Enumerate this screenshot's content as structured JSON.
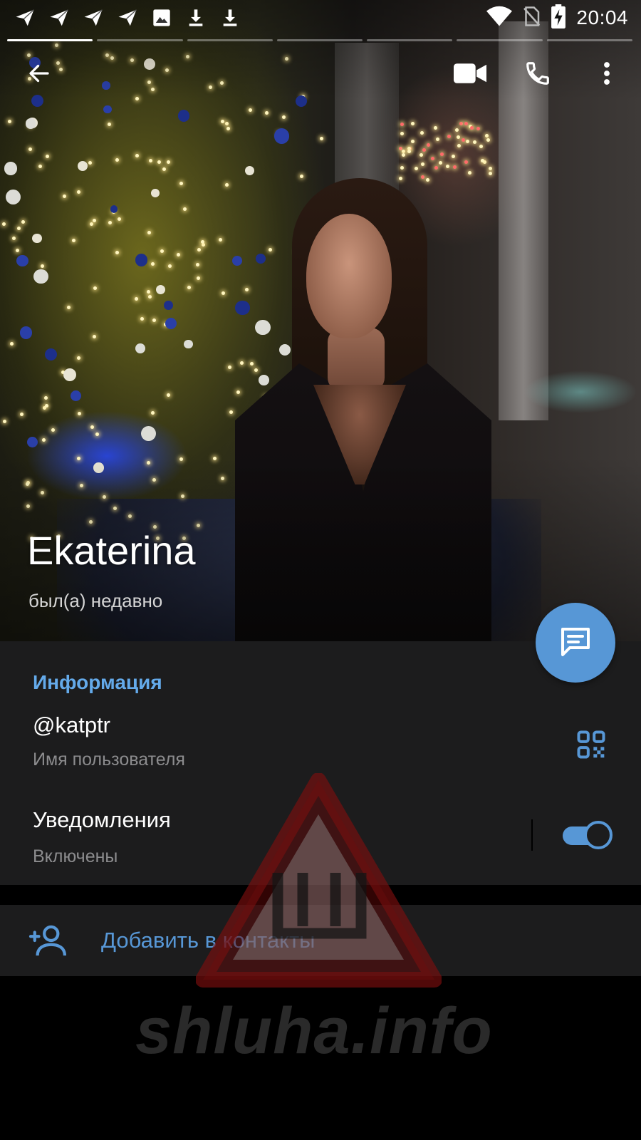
{
  "status_bar": {
    "time": "20:04",
    "left_icons": [
      "telegram-icon",
      "telegram-icon",
      "telegram-icon",
      "telegram-icon",
      "image-icon",
      "download-icon",
      "download-icon"
    ],
    "right_icons": [
      "wifi-icon",
      "no-sim-icon",
      "battery-charging-icon"
    ]
  },
  "profile": {
    "name": "Ekaterina",
    "last_seen": "был(а) недавно"
  },
  "toolbar": {
    "back": "back-arrow-icon",
    "video_call": "video-camera-icon",
    "call": "phone-icon",
    "menu": "more-vert-icon"
  },
  "info": {
    "heading": "Информация",
    "username": "@katptr",
    "username_label": "Имя пользователя",
    "notifications": "Уведомления",
    "notifications_state": "Включены",
    "notifications_on": true
  },
  "actions": {
    "add_contact": "Добавить в контакты"
  },
  "watermark": {
    "text": "shluha.info",
    "logo_letter": "Ш"
  },
  "colors": {
    "accent": "#5797d6",
    "heading": "#64aaea",
    "panel": "#1c1c1d",
    "watermark_red": "#8a1a1a"
  }
}
